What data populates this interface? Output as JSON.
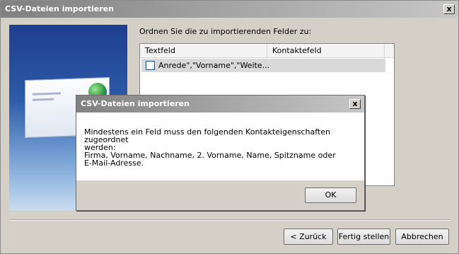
{
  "window": {
    "title": "CSV-Dateien importieren",
    "close_label": "x"
  },
  "instruction": "Ordnen Sie die zu importierenden Felder zu:",
  "listview": {
    "columns": [
      "Textfeld",
      "Kontaktefeld"
    ],
    "rows": [
      {
        "text": "Anrede\",\"Vorname\",\"Weite...",
        "checked": false
      }
    ]
  },
  "buttons": {
    "back": "< Zurück",
    "finish": "Fertig stellen",
    "cancel": "Abbrechen"
  },
  "dialog": {
    "title": "CSV-Dateien importieren",
    "close_label": "x",
    "message": "Mindestens ein Feld muss den folgenden Kontakteigenschaften zugeordnet\nwerden:\nFirma, Vorname, Nachname, 2. Vorname, Name, Spitzname oder\nE-Mail-Adresse.",
    "ok": "OK"
  }
}
